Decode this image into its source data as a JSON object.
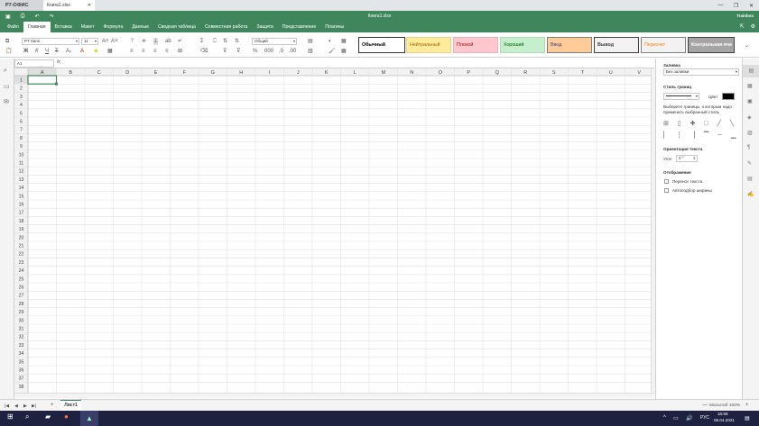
{
  "window": {
    "app_tab": "Р7-ОФИС",
    "file_tab": "Книга1.xlsx",
    "doc_title": "Книга1.xlsx",
    "user": "Trainbox"
  },
  "menu": {
    "tabs": [
      "Файл",
      "Главная",
      "Вставка",
      "Макет",
      "Формула",
      "Данные",
      "Сводная таблица",
      "Совместная работа",
      "Защита",
      "Представление",
      "Плагины"
    ],
    "active": "Главная"
  },
  "toolbar": {
    "font_name": "PT Sans",
    "font_size": "11",
    "number_format": "Общий"
  },
  "cell_styles": [
    {
      "label": "Обычный",
      "bg": "#ffffff",
      "color": "#000000",
      "border": "#333333",
      "bold": true
    },
    {
      "label": "Нейтральный",
      "bg": "#ffeb9c",
      "color": "#9c6500",
      "border": "#e5d28a",
      "bold": false
    },
    {
      "label": "Плохой",
      "bg": "#ffc7ce",
      "color": "#9c0006",
      "border": "#e5b3b9",
      "bold": false
    },
    {
      "label": "Хороший",
      "bg": "#c6efce",
      "color": "#006100",
      "border": "#b2d7b9",
      "bold": false
    },
    {
      "label": "Ввод",
      "bg": "#ffcc99",
      "color": "#3f3f76",
      "border": "#7f7f7f",
      "bold": false
    },
    {
      "label": "Вывод",
      "bg": "#f2f2f2",
      "color": "#3f3f3f",
      "border": "#3f3f3f",
      "bold": true
    },
    {
      "label": "Пересчет",
      "bg": "#f2f2f2",
      "color": "#fa7d00",
      "border": "#7f7f7f",
      "bold": false
    },
    {
      "label": "Контрольная яче",
      "bg": "#a5a5a5",
      "color": "#ffffff",
      "border": "#3f3f3f",
      "bold": true
    }
  ],
  "formula_bar": {
    "cell_ref": "A1",
    "fx": "fx"
  },
  "columns": [
    "A",
    "B",
    "C",
    "D",
    "E",
    "F",
    "G",
    "H",
    "I",
    "J",
    "K",
    "L",
    "M",
    "N",
    "O",
    "P",
    "Q",
    "R",
    "S",
    "T",
    "U",
    "V"
  ],
  "rows": [
    "1",
    "2",
    "3",
    "4",
    "5",
    "6",
    "7",
    "8",
    "9",
    "10",
    "11",
    "12",
    "13",
    "14",
    "15",
    "16",
    "17",
    "18",
    "19",
    "20",
    "21",
    "22",
    "23",
    "24",
    "25",
    "26",
    "27",
    "28",
    "29",
    "30",
    "31",
    "32",
    "33",
    "34",
    "35",
    "36",
    "37",
    "38"
  ],
  "right_panel": {
    "fill_title": "Заливка",
    "fill_value": "Без заливки",
    "border_style_title": "Стиль границ",
    "color_label": "Цвет",
    "hint": "Выберите границы, к которым надо применить выбранный стиль",
    "orientation_title": "Ориентация текста",
    "angle_label": "Угол",
    "angle_value": "0 °",
    "display_title": "Отображение",
    "wrap_text": "Перенос текста",
    "autofit": "Автоподбор ширины"
  },
  "sheet": {
    "tab": "Лист1",
    "zoom": "Масштаб 100%"
  },
  "taskbar": {
    "lang": "РУС",
    "time": "16:58",
    "date": "06.04.2021"
  },
  "colors": {
    "accent": "#40865c",
    "taskbar": "#1e2240"
  }
}
